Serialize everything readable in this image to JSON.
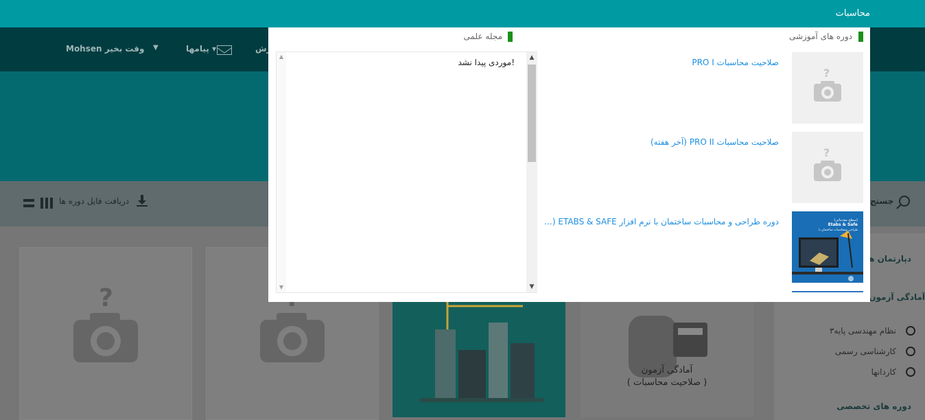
{
  "app": {
    "title": "محاسبات"
  },
  "background": {
    "nav": {
      "greeting": "Mohsen وقت بخیر",
      "messages": "پیامها",
      "cut_item": "رش"
    },
    "toolbar": {
      "download_label": "دریافت فایل دوره ها",
      "search_label": "جستج"
    },
    "sidebar": {
      "title": "دپارتمان ها",
      "section_1": "آمادگی آزمون",
      "options": [
        "نظام مهندسی پایه۳",
        "کارشناسی رسمی",
        "کاردانها"
      ],
      "section_2": "دوره های تخصصی"
    },
    "person_card": {
      "line_1": "آمادگی آزمون",
      "line_2": "( صلاحیت محاسبات )"
    }
  },
  "modal": {
    "courses_title": "دوره های آموزشی",
    "journal_title": "مجله علمی",
    "courses": [
      {
        "title": "صلاحیت محاسبات PRO I",
        "thumb": "placeholder-camera"
      },
      {
        "title": "صلاحیت محاسبات PRO II (آخر هفته)",
        "thumb": "placeholder-camera"
      },
      {
        "title": "دوره طراحی و محاسبات ساختمان با نرم افزار ETABS & SAFE (س...",
        "thumb": "etabs-course-image"
      }
    ],
    "journal_empty": "موردی پیدا نشد!",
    "thumb_text": {
      "line_1": "(سطح مقدماتی)",
      "line_2": "Etabs & Safe",
      "line_3": "طراحی ومحاسبات ساختمان با"
    }
  },
  "colors": {
    "header": "#009aa3",
    "link": "#1e8fe0",
    "marker": "#1b8f1b"
  }
}
